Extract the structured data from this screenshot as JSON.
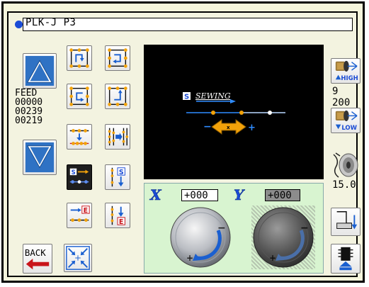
{
  "header": {
    "title": "PLK-J P3",
    "indicator_color": "#1a4bd6"
  },
  "feed": {
    "label": "FEED",
    "values": [
      "00000",
      "00239",
      "00219"
    ]
  },
  "nav": {
    "up_icon": "triangle-up-icon",
    "down_icon": "triangle-down-icon",
    "back_label": "BACK"
  },
  "monitor": {
    "mode_badge": "S",
    "mode_label": "SEWING",
    "direction_minus": "−",
    "direction_plus": "+"
  },
  "jog_panel": {
    "x_label": "X",
    "x_value": "+000",
    "y_label": "Y",
    "y_value": "+000",
    "x_dial_enabled": true,
    "y_dial_enabled": false
  },
  "right_panel": {
    "high_label": "HIGH",
    "speed_values": [
      "9",
      "200"
    ],
    "low_label": "LOW",
    "tension_value": "15.0"
  },
  "colors": {
    "frame_bg": "#f3f3e0",
    "monitor_bg": "#000000",
    "jog_bg": "#d8f4d0",
    "nav_blue": "#2f72c4",
    "accent_orange": "#f2a20a"
  }
}
